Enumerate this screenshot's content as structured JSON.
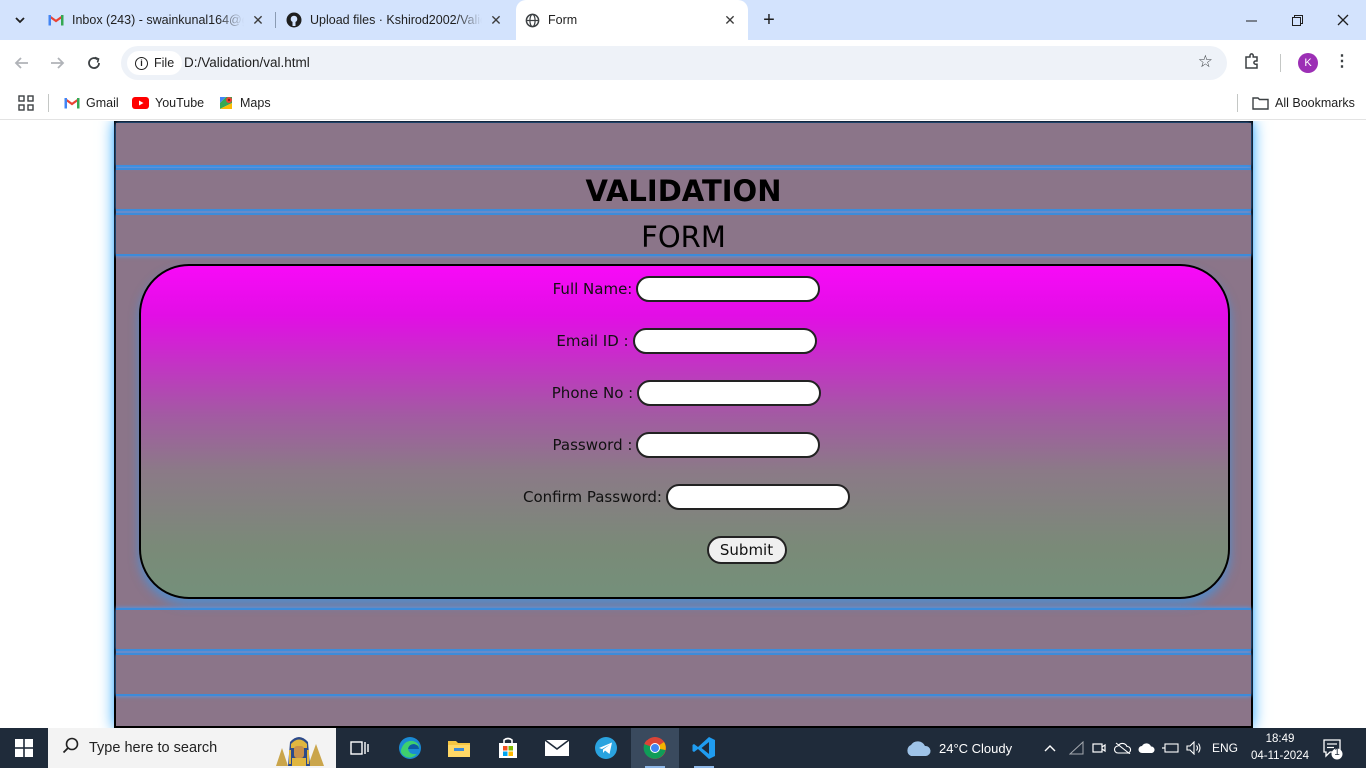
{
  "browser": {
    "tabs": [
      {
        "title": "Inbox (243) - swainkunal164@g",
        "icon": "gmail-icon",
        "active": false
      },
      {
        "title": "Upload files · Kshirod2002/Valid",
        "icon": "github-icon",
        "active": false
      },
      {
        "title": "Form",
        "icon": "globe-icon",
        "active": true
      }
    ],
    "address": {
      "chip_label": "File",
      "url": "D:/Validation/val.html"
    },
    "profile_initial": "K",
    "bookmarks": [
      {
        "label": "Gmail",
        "icon": "gmail-icon"
      },
      {
        "label": "YouTube",
        "icon": "youtube-icon"
      },
      {
        "label": "Maps",
        "icon": "maps-icon"
      }
    ],
    "all_bookmarks_label": "All Bookmarks"
  },
  "page": {
    "heading": "VALIDATION",
    "subheading": "FORM",
    "form": {
      "full_name_label": "Full Name:",
      "email_label": "Email ID :",
      "phone_label": "Phone No :",
      "password_label": "Password :",
      "confirm_password_label": "Confirm Password:",
      "submit_label": "Submit"
    },
    "colors": {
      "page_background": "#8b7589",
      "band_border": "#3d8bd9",
      "form_gradient_top": "#f80af8",
      "form_gradient_bottom": "#74907a"
    }
  },
  "taskbar": {
    "search_placeholder": "Type here to search",
    "weather": "24°C  Cloudy",
    "language": "ENG",
    "time": "18:49",
    "date": "04-11-2024",
    "notification_count": "1",
    "pinned": [
      "task-view-icon",
      "edge-icon",
      "file-explorer-icon",
      "store-icon",
      "mail-icon",
      "telegram-icon",
      "chrome-icon",
      "vscode-icon"
    ]
  }
}
